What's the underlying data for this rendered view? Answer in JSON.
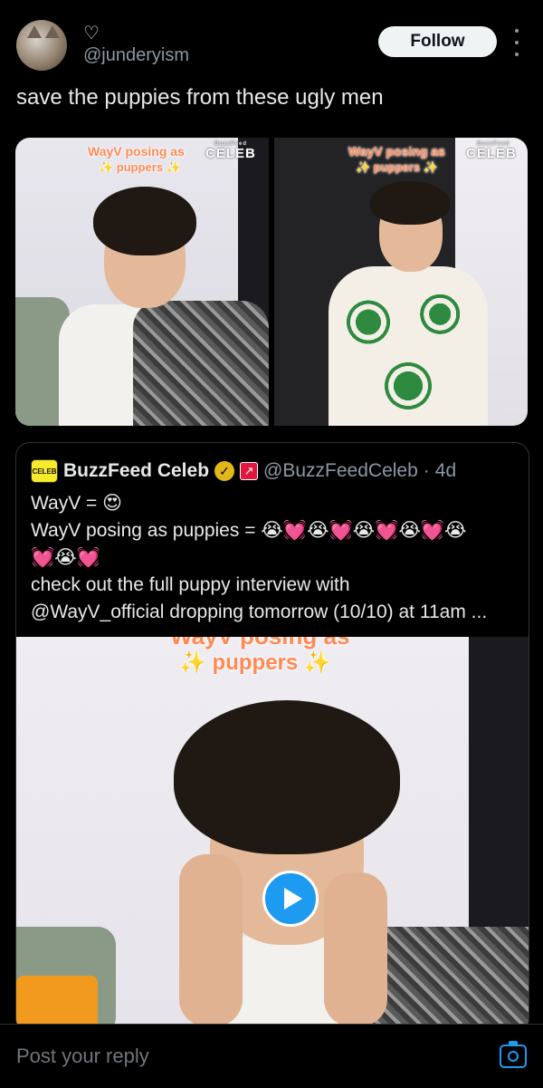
{
  "post": {
    "display_name_icon": "heart-outline-icon",
    "display_name": "♡",
    "handle": "@junderyism",
    "follow_label": "Follow",
    "text": "save the puppies from these ugly men",
    "media": [
      {
        "caption_line1": "WayV posing as",
        "caption_line2": "✨ puppers ✨",
        "brand_small": "BuzzFeed",
        "brand": "CELEB"
      },
      {
        "caption_line1": "WayV posing as",
        "caption_line2": "✨ puppers ✨",
        "brand_small": "BuzzFeed",
        "brand": "CELEB"
      }
    ]
  },
  "quote": {
    "logo_text": "CELEB",
    "name": "BuzzFeed Celeb",
    "handle": "@BuzzFeedCeleb",
    "separator": "·",
    "time": "4d",
    "lines": [
      "WayV = 😍",
      "WayV posing as puppies = 😭💓😭💓😭💓😭💓😭",
      "💓😭💓",
      " check out the full puppy interview with",
      "@WayV_official dropping tomorrow (10/10) at 11am ..."
    ],
    "media_caption_top": "WayV posing as",
    "media_caption": "✨ puppers ✨"
  },
  "reply": {
    "placeholder": "Post your reply"
  },
  "colors": {
    "accent": "#1d9bf0",
    "background": "#000000",
    "text": "#e7e9ea",
    "muted": "#8b98a5"
  }
}
